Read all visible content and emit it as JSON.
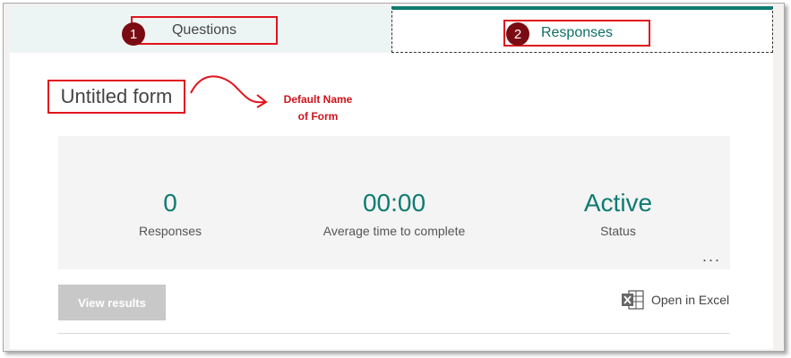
{
  "tabs": {
    "questions": {
      "number": "1",
      "label": "Questions"
    },
    "responses": {
      "number": "2",
      "label": "Responses"
    }
  },
  "form": {
    "title": "Untitled form"
  },
  "annotation": {
    "line1": "Default Name",
    "line2": "of Form"
  },
  "stats": [
    {
      "value": "0",
      "label": "Responses"
    },
    {
      "value": "00:00",
      "label": "Average time to complete"
    },
    {
      "value": "Active",
      "label": "Status"
    }
  ],
  "more_label": "...",
  "buttons": {
    "view_results": "View results",
    "open_in_excel": "Open in Excel"
  },
  "colors": {
    "accent": "#0f7b72",
    "annotation_red": "#e0141e",
    "badge": "#7a0b12"
  }
}
